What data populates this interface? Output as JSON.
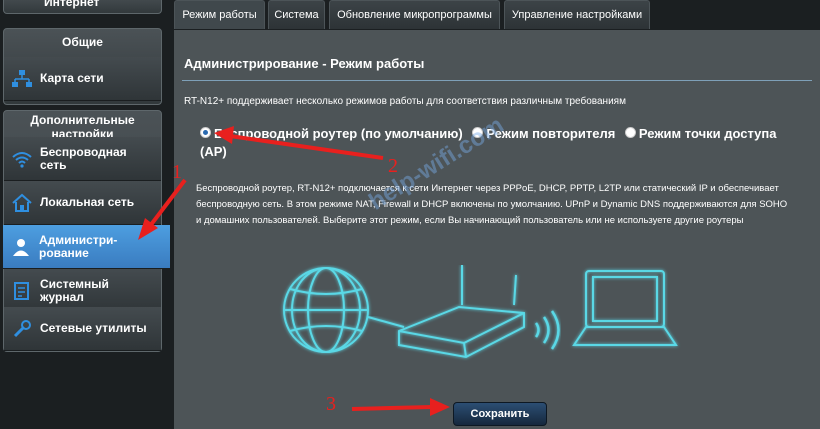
{
  "sidebar": {
    "top_item": "Интернет",
    "section_general": "Общие",
    "network_map": "Карта сети",
    "section_advanced": "Дополнительные настройки",
    "items": [
      {
        "label": "Беспроводная сеть",
        "icon": "wifi-icon"
      },
      {
        "label": "Локальная сеть",
        "icon": "home-icon"
      },
      {
        "label": "Администри- рование",
        "icon": "user-icon"
      },
      {
        "label": "Системный журнал",
        "icon": "log-icon"
      },
      {
        "label": "Сетевые утилиты",
        "icon": "tools-icon"
      }
    ]
  },
  "tabs": [
    "Режим работы",
    "Система",
    "Обновление микропрограммы",
    "Управление настройками"
  ],
  "main": {
    "title": "Администрирование - Режим работы",
    "intro": "RT-N12+ поддерживает несколько режимов работы для соответствия различным требованиям",
    "modes": [
      "Беспроводной роутер (по умолчанию)",
      "Режим повторителя",
      "Режим точки доступа (AP)"
    ],
    "description": "Беспроводной роутер, RT-N12+ подключается к сети Интернет через PPPoE, DHCP, PPTP, L2TP или статический IP и обеспечивает беспроводную сеть. В этом режиме NAT, Firewall и DHCP включены по умолчанию. UPnP и Dynamic DNS поддерживаются для SOHO и домашних пользователей. Выберите этот режим, если Вы начинающий пользователь или не используете другие роутеры",
    "save_label": "Сохранить"
  },
  "annotations": [
    "1",
    "2",
    "3"
  ],
  "watermark": "help-wifi.com",
  "colors": {
    "accent": "#3a8fd8",
    "arrow": "#e8201e",
    "glow": "#5ad8e6"
  }
}
